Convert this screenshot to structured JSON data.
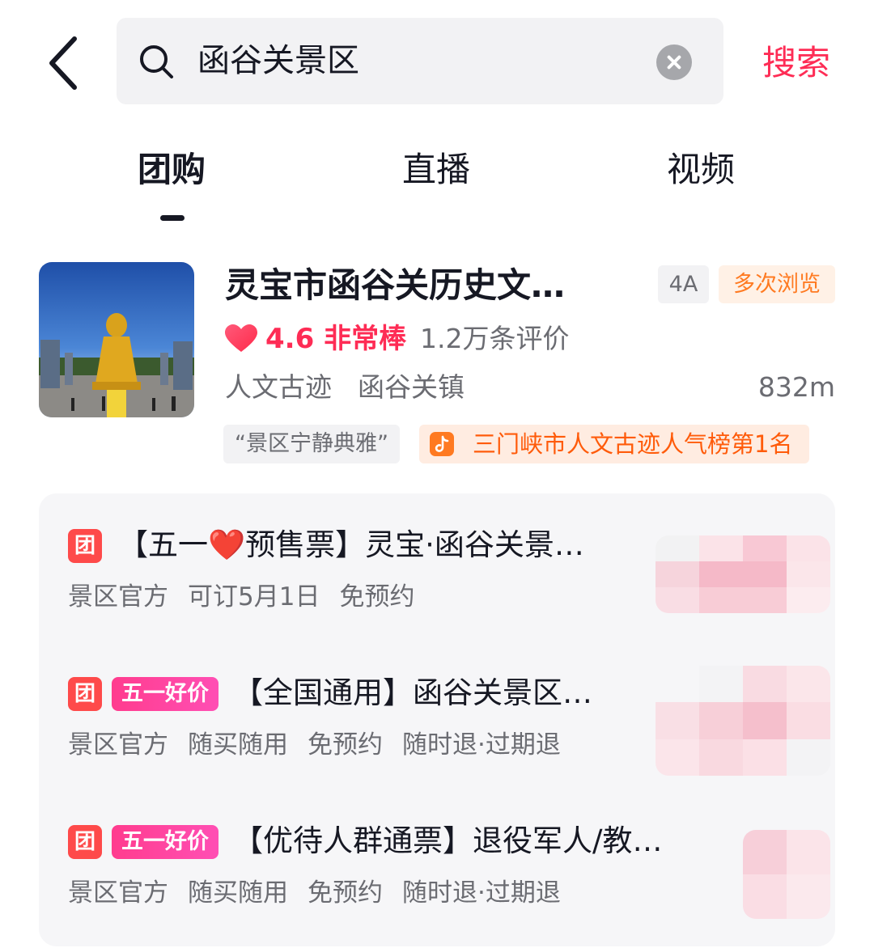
{
  "header": {
    "search_query": "函谷关景区",
    "search_button": "搜索"
  },
  "tabs": [
    {
      "label": "团购",
      "active": true
    },
    {
      "label": "直播",
      "active": false
    },
    {
      "label": "视频",
      "active": false
    }
  ],
  "poi": {
    "title": "灵宝市函谷关历史文…",
    "level_tag": "4A",
    "visit_tag": "多次浏览",
    "rating": "4.6 非常棒",
    "reviews": "1.2万条评价",
    "category": "人文古迹",
    "area": "函谷关镇",
    "distance": "832m",
    "quote": "“景区宁静典雅”",
    "rank_text": "三门峡市人文古迹人气榜第1名"
  },
  "deals": [
    {
      "tuan_icon": "团",
      "promo": "",
      "title": "【五一❤️预售票】灵宝·函谷关景…",
      "meta": [
        "景区官方",
        "可订5月1日",
        "免预约"
      ]
    },
    {
      "tuan_icon": "团",
      "promo": "五一好价",
      "title": "【全国通用】函谷关景区…",
      "meta": [
        "景区官方",
        "随买随用",
        "免预约",
        "随时退·过期退"
      ]
    },
    {
      "tuan_icon": "团",
      "promo": "五一好价",
      "title": "【优待人群通票】退役军人/教…",
      "meta": [
        "景区官方",
        "随买随用",
        "免预约",
        "随时退·过期退"
      ]
    }
  ],
  "colors": {
    "brand": "#fe2c55",
    "tuan": "#fe4a4a",
    "promo": "#ff3c8e",
    "rank": "#ff5b0a"
  },
  "icons": [
    "back-arrow-icon",
    "search-icon",
    "clear-icon",
    "heart-icon",
    "douyin-icon"
  ]
}
